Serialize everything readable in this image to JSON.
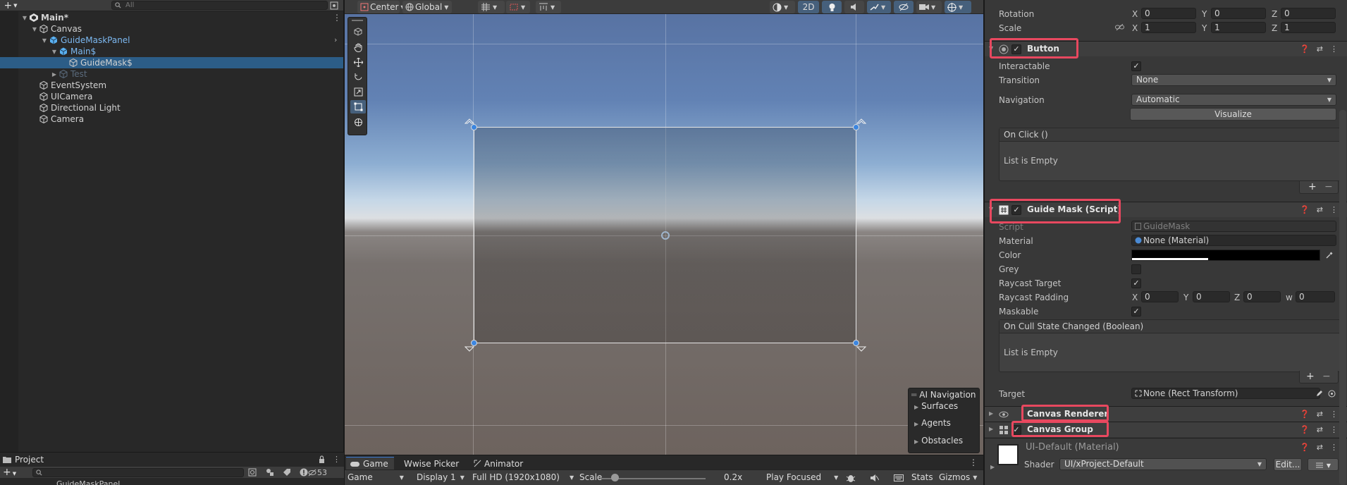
{
  "hierarchy": {
    "search_placeholder": "All",
    "items": [
      {
        "label": "Main*",
        "depth": 0,
        "kind": "scene",
        "expanded": true
      },
      {
        "label": "Canvas",
        "depth": 1,
        "kind": "object",
        "expanded": true
      },
      {
        "label": "GuideMaskPanel",
        "depth": 2,
        "kind": "prefab",
        "expanded": true
      },
      {
        "label": "Main$",
        "depth": 3,
        "kind": "prefab",
        "expanded": true
      },
      {
        "label": "GuideMask$",
        "depth": 4,
        "kind": "object",
        "selected": true
      },
      {
        "label": "Test",
        "depth": 3,
        "kind": "disabled",
        "expanded": false
      },
      {
        "label": "EventSystem",
        "depth": 1,
        "kind": "object"
      },
      {
        "label": "UICamera",
        "depth": 1,
        "kind": "object"
      },
      {
        "label": "Directional Light",
        "depth": 1,
        "kind": "object"
      },
      {
        "label": "Camera",
        "depth": 1,
        "kind": "object"
      }
    ]
  },
  "project": {
    "tab": "Project",
    "hidden_count": "53",
    "peek": "GuideMaskPanel"
  },
  "scene_toolbar": {
    "pivot": "Center",
    "space": "Global",
    "mode_2d": "2D"
  },
  "ai_navigation": {
    "title": "AI Navigation",
    "items": [
      "Surfaces",
      "Agents",
      "Obstacles"
    ]
  },
  "game_tabs": [
    "Game",
    "Wwise Picker",
    "Animator"
  ],
  "game_bar": {
    "view": "Game",
    "display": "Display 1",
    "resolution": "Full HD (1920x1080)",
    "scale_label": "Scale",
    "scale_value": "0.2x",
    "scale_fraction": 0.14,
    "play_mode": "Play Focused",
    "stats": "Stats",
    "gizmos": "Gizmos"
  },
  "inspector": {
    "rotation": {
      "label": "Rotation",
      "x": "0",
      "y": "0",
      "z": "0"
    },
    "scale": {
      "label": "Scale",
      "x": "1",
      "y": "1",
      "z": "1"
    },
    "button": {
      "title": "Button",
      "interactable_label": "Interactable",
      "transition_label": "Transition",
      "transition_value": "None",
      "navigation_label": "Navigation",
      "navigation_value": "Automatic",
      "visualize": "Visualize",
      "onclick_header": "On Click ()",
      "onclick_empty": "List is Empty"
    },
    "guide_mask": {
      "title": "Guide Mask (Script)",
      "script_label": "Script",
      "script_value": "GuideMask",
      "material_label": "Material",
      "material_value": "None (Material)",
      "color_label": "Color",
      "grey_label": "Grey",
      "raycast_target_label": "Raycast Target",
      "raycast_padding_label": "Raycast Padding",
      "padding": {
        "x": "0",
        "y": "0",
        "z": "0",
        "w": "0"
      },
      "maskable_label": "Maskable",
      "cull_header": "On Cull State Changed (Boolean)",
      "cull_empty": "List is Empty",
      "target_label": "Target",
      "target_value": "None (Rect Transform)"
    },
    "canvas_renderer": {
      "title": "Canvas Renderer"
    },
    "canvas_group": {
      "title": "Canvas Group"
    },
    "material": {
      "title": "UI-Default (Material)",
      "shader_label": "Shader",
      "shader_value": "UI/xProject-Default",
      "edit": "Edit..."
    },
    "axes": {
      "x": "X",
      "y": "Y",
      "z": "Z",
      "w": "W"
    }
  },
  "colors": {
    "highlight": "#e8485f",
    "selection": "#2c5d87",
    "prefab_text": "#7cb8f0"
  }
}
